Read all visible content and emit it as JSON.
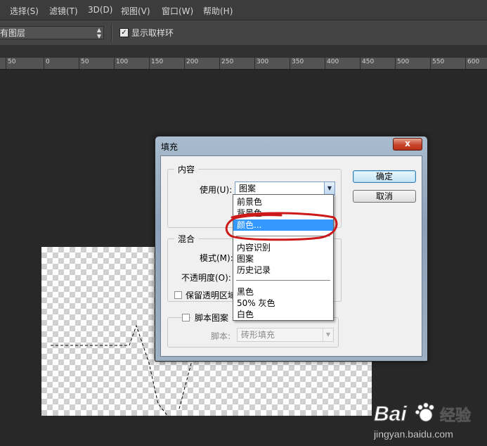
{
  "menubar": {
    "items": [
      "选择(S)",
      "滤镜(T)",
      "3D(D)",
      "视图(V)",
      "窗口(W)",
      "帮助(H)"
    ]
  },
  "options_bar": {
    "sample_select_value": "有图层",
    "show_ring_label": "显示取样环",
    "show_ring_checked": true
  },
  "ruler": {
    "labels": [
      "50",
      "0",
      "50",
      "100",
      "150",
      "200",
      "250",
      "300",
      "350",
      "400",
      "450",
      "500",
      "550",
      "600"
    ]
  },
  "dialog": {
    "title": "填充",
    "close_label": "x",
    "content_group": "内容",
    "use_label": "使用(U):",
    "use_value": "图案",
    "blend_group": "混合",
    "mode_label": "模式(M):",
    "opacity_label": "不透明度(O):",
    "preserve_label": "保留透明区域",
    "script_pattern_label": "脚本图案",
    "script_label": "脚本:",
    "script_value": "砖形填充",
    "ok_label": "确定",
    "cancel_label": "取消"
  },
  "dropdown": {
    "items": [
      "前景色",
      "背景色",
      "颜色...",
      "内容识别",
      "图案",
      "历史记录",
      "黑色",
      "50% 灰色",
      "白色"
    ],
    "selected": "颜色..."
  },
  "watermark": {
    "brand": "Baidu",
    "brand_cn": "经验",
    "url": "jingyan.baidu.com"
  },
  "colors": {
    "selection": "#3399ff",
    "annotation_ring": "#cc1a1a",
    "workspace": "#282828"
  }
}
